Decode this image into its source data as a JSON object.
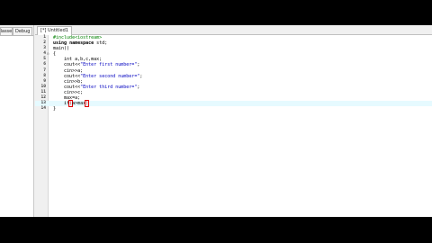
{
  "left_panel": {
    "tabs": [
      "Classes",
      "Debug"
    ]
  },
  "editor": {
    "tab_label": "[*] Untitled1",
    "lines": [
      {
        "n": "1",
        "fold": "",
        "text": "#include<iostream>",
        "cls": "pp"
      },
      {
        "n": "2",
        "fold": "",
        "text": "using namespace std;",
        "cls": "kw"
      },
      {
        "n": "3",
        "fold": "",
        "text": "main()",
        "cls": ""
      },
      {
        "n": "4",
        "fold": "⊟",
        "text": "{",
        "cls": ""
      },
      {
        "n": "5",
        "fold": "",
        "text": "    int a,b,c,max;",
        "cls": ""
      },
      {
        "n": "6",
        "fold": "",
        "text": "    cout<<\"Enter first number=\";",
        "cls": "str"
      },
      {
        "n": "7",
        "fold": "",
        "text": "    cin>>a;",
        "cls": ""
      },
      {
        "n": "8",
        "fold": "",
        "text": "    cout<<\"Enter second number=\";",
        "cls": "str"
      },
      {
        "n": "9",
        "fold": "",
        "text": "    cin>>b;",
        "cls": ""
      },
      {
        "n": "10",
        "fold": "",
        "text": "    cout<<\"Enter third number=\";",
        "cls": "str"
      },
      {
        "n": "11",
        "fold": "",
        "text": "    cin>>c;",
        "cls": ""
      },
      {
        "n": "12",
        "fold": "",
        "text": "    max=a;",
        "cls": ""
      },
      {
        "n": "13",
        "fold": "",
        "text": "    if(a>max)",
        "cls": "current"
      },
      {
        "n": "14",
        "fold": "",
        "text": "}",
        "cls": ""
      }
    ]
  }
}
